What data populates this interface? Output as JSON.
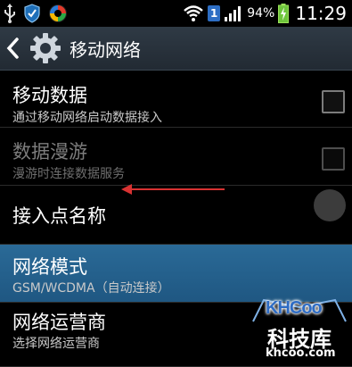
{
  "status_bar": {
    "battery_percent": "94%",
    "time": "11:29",
    "sim_badge": "1"
  },
  "action_bar": {
    "title": "移动网络"
  },
  "settings": [
    {
      "title": "移动数据",
      "subtitle": "通过移动网络启动数据接入",
      "checked": false,
      "enabled": true
    },
    {
      "title": "数据漫游",
      "subtitle": "漫游时连接数据服务",
      "checked": false,
      "enabled": false
    },
    {
      "title": "接入点名称"
    },
    {
      "title": "网络模式",
      "subtitle": "GSM/WCDMA（自动连接）",
      "highlighted": true
    },
    {
      "title": "网络运营商",
      "subtitle": "选择网络运营商"
    }
  ],
  "watermark": {
    "logo": "KHCoo",
    "name": "科技库",
    "url": "khcoo.com"
  },
  "colors": {
    "action_bar": "#27313b",
    "highlight": "#24628d",
    "annotation_arrow": "#d83232",
    "sim_badge": "#2d6ec4"
  }
}
